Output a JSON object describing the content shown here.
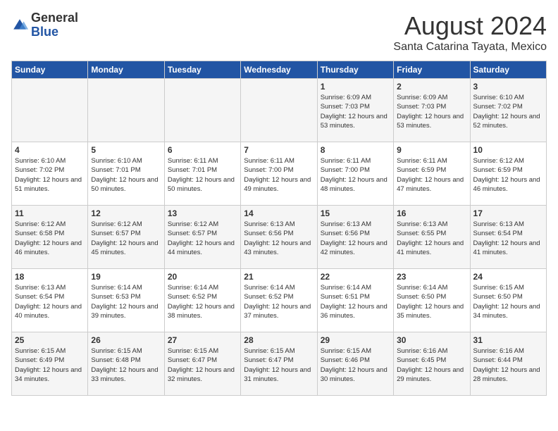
{
  "header": {
    "logo": {
      "general": "General",
      "blue": "Blue"
    },
    "title": "August 2024",
    "location": "Santa Catarina Tayata, Mexico"
  },
  "weekdays": [
    "Sunday",
    "Monday",
    "Tuesday",
    "Wednesday",
    "Thursday",
    "Friday",
    "Saturday"
  ],
  "weeks": [
    [
      {
        "day": "",
        "info": ""
      },
      {
        "day": "",
        "info": ""
      },
      {
        "day": "",
        "info": ""
      },
      {
        "day": "",
        "info": ""
      },
      {
        "day": "1",
        "info": "Sunrise: 6:09 AM\nSunset: 7:03 PM\nDaylight: 12 hours\nand 53 minutes."
      },
      {
        "day": "2",
        "info": "Sunrise: 6:09 AM\nSunset: 7:03 PM\nDaylight: 12 hours\nand 53 minutes."
      },
      {
        "day": "3",
        "info": "Sunrise: 6:10 AM\nSunset: 7:02 PM\nDaylight: 12 hours\nand 52 minutes."
      }
    ],
    [
      {
        "day": "4",
        "info": "Sunrise: 6:10 AM\nSunset: 7:02 PM\nDaylight: 12 hours\nand 51 minutes."
      },
      {
        "day": "5",
        "info": "Sunrise: 6:10 AM\nSunset: 7:01 PM\nDaylight: 12 hours\nand 50 minutes."
      },
      {
        "day": "6",
        "info": "Sunrise: 6:11 AM\nSunset: 7:01 PM\nDaylight: 12 hours\nand 50 minutes."
      },
      {
        "day": "7",
        "info": "Sunrise: 6:11 AM\nSunset: 7:00 PM\nDaylight: 12 hours\nand 49 minutes."
      },
      {
        "day": "8",
        "info": "Sunrise: 6:11 AM\nSunset: 7:00 PM\nDaylight: 12 hours\nand 48 minutes."
      },
      {
        "day": "9",
        "info": "Sunrise: 6:11 AM\nSunset: 6:59 PM\nDaylight: 12 hours\nand 47 minutes."
      },
      {
        "day": "10",
        "info": "Sunrise: 6:12 AM\nSunset: 6:59 PM\nDaylight: 12 hours\nand 46 minutes."
      }
    ],
    [
      {
        "day": "11",
        "info": "Sunrise: 6:12 AM\nSunset: 6:58 PM\nDaylight: 12 hours\nand 46 minutes."
      },
      {
        "day": "12",
        "info": "Sunrise: 6:12 AM\nSunset: 6:57 PM\nDaylight: 12 hours\nand 45 minutes."
      },
      {
        "day": "13",
        "info": "Sunrise: 6:12 AM\nSunset: 6:57 PM\nDaylight: 12 hours\nand 44 minutes."
      },
      {
        "day": "14",
        "info": "Sunrise: 6:13 AM\nSunset: 6:56 PM\nDaylight: 12 hours\nand 43 minutes."
      },
      {
        "day": "15",
        "info": "Sunrise: 6:13 AM\nSunset: 6:56 PM\nDaylight: 12 hours\nand 42 minutes."
      },
      {
        "day": "16",
        "info": "Sunrise: 6:13 AM\nSunset: 6:55 PM\nDaylight: 12 hours\nand 41 minutes."
      },
      {
        "day": "17",
        "info": "Sunrise: 6:13 AM\nSunset: 6:54 PM\nDaylight: 12 hours\nand 41 minutes."
      }
    ],
    [
      {
        "day": "18",
        "info": "Sunrise: 6:13 AM\nSunset: 6:54 PM\nDaylight: 12 hours\nand 40 minutes."
      },
      {
        "day": "19",
        "info": "Sunrise: 6:14 AM\nSunset: 6:53 PM\nDaylight: 12 hours\nand 39 minutes."
      },
      {
        "day": "20",
        "info": "Sunrise: 6:14 AM\nSunset: 6:52 PM\nDaylight: 12 hours\nand 38 minutes."
      },
      {
        "day": "21",
        "info": "Sunrise: 6:14 AM\nSunset: 6:52 PM\nDaylight: 12 hours\nand 37 minutes."
      },
      {
        "day": "22",
        "info": "Sunrise: 6:14 AM\nSunset: 6:51 PM\nDaylight: 12 hours\nand 36 minutes."
      },
      {
        "day": "23",
        "info": "Sunrise: 6:14 AM\nSunset: 6:50 PM\nDaylight: 12 hours\nand 35 minutes."
      },
      {
        "day": "24",
        "info": "Sunrise: 6:15 AM\nSunset: 6:50 PM\nDaylight: 12 hours\nand 34 minutes."
      }
    ],
    [
      {
        "day": "25",
        "info": "Sunrise: 6:15 AM\nSunset: 6:49 PM\nDaylight: 12 hours\nand 34 minutes."
      },
      {
        "day": "26",
        "info": "Sunrise: 6:15 AM\nSunset: 6:48 PM\nDaylight: 12 hours\nand 33 minutes."
      },
      {
        "day": "27",
        "info": "Sunrise: 6:15 AM\nSunset: 6:47 PM\nDaylight: 12 hours\nand 32 minutes."
      },
      {
        "day": "28",
        "info": "Sunrise: 6:15 AM\nSunset: 6:47 PM\nDaylight: 12 hours\nand 31 minutes."
      },
      {
        "day": "29",
        "info": "Sunrise: 6:15 AM\nSunset: 6:46 PM\nDaylight: 12 hours\nand 30 minutes."
      },
      {
        "day": "30",
        "info": "Sunrise: 6:16 AM\nSunset: 6:45 PM\nDaylight: 12 hours\nand 29 minutes."
      },
      {
        "day": "31",
        "info": "Sunrise: 6:16 AM\nSunset: 6:44 PM\nDaylight: 12 hours\nand 28 minutes."
      }
    ]
  ]
}
